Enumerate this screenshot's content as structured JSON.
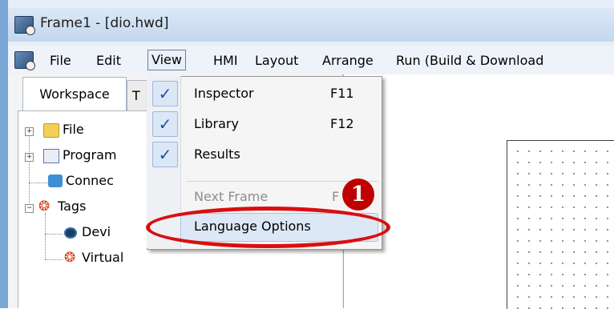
{
  "window": {
    "title": "Frame1 - [dio.hwd]"
  },
  "menubar": {
    "items": [
      "File",
      "Edit",
      "View",
      "HMI",
      "Layout",
      "Arrange",
      "Run (Build & Download"
    ]
  },
  "tabs": {
    "workspace": "Workspace",
    "second": "T"
  },
  "tree": {
    "items": [
      {
        "label": "File",
        "icon": "folder-icon"
      },
      {
        "label": "Program",
        "icon": "program-icon"
      },
      {
        "label": "Connec",
        "icon": "connection-icon"
      },
      {
        "label": "Tags",
        "icon": "tags-icon"
      },
      {
        "label": "Devi",
        "icon": "device-icon"
      },
      {
        "label": "Virtual",
        "icon": "virtual-icon"
      }
    ]
  },
  "view_menu": {
    "items": [
      {
        "label": "Inspector",
        "shortcut": "F11",
        "checked": true
      },
      {
        "label": "Library",
        "shortcut": "F12",
        "checked": true
      },
      {
        "label": "Results",
        "shortcut": "",
        "checked": true
      },
      {
        "label": "Next Frame",
        "shortcut": "F",
        "checked": false,
        "disabled": true
      },
      {
        "label": "Language Options",
        "shortcut": "",
        "checked": false,
        "highlighted": true
      }
    ],
    "check_glyph": "✓"
  },
  "annotation": {
    "badge": "1"
  },
  "colors": {
    "accent_red": "#d80f10",
    "badge": "#c00000",
    "check": "#1f4fa3"
  }
}
